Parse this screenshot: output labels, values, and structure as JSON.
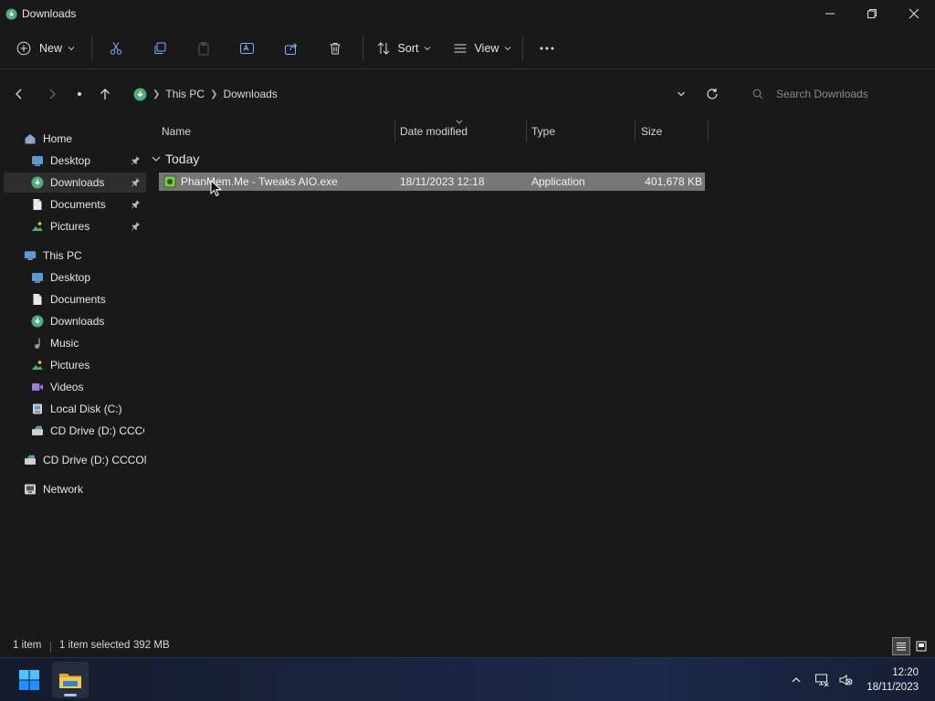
{
  "window": {
    "title": "Downloads"
  },
  "toolbar": {
    "new_label": "New",
    "sort_label": "Sort",
    "view_label": "View"
  },
  "address": {
    "segments": [
      "This PC",
      "Downloads"
    ]
  },
  "search": {
    "placeholder": "Search Downloads"
  },
  "sidebar": {
    "home": "Home",
    "quick_access": [
      {
        "label": "Desktop",
        "icon": "desktop-icon"
      },
      {
        "label": "Downloads",
        "icon": "download-icon"
      },
      {
        "label": "Documents",
        "icon": "document-icon"
      },
      {
        "label": "Pictures",
        "icon": "pictures-icon"
      }
    ],
    "this_pc": "This PC",
    "this_pc_items": [
      {
        "label": "Desktop",
        "icon": "desktop-icon"
      },
      {
        "label": "Documents",
        "icon": "document-icon"
      },
      {
        "label": "Downloads",
        "icon": "download-icon"
      },
      {
        "label": "Music",
        "icon": "music-icon"
      },
      {
        "label": "Pictures",
        "icon": "pictures-icon"
      },
      {
        "label": "Videos",
        "icon": "videos-icon"
      },
      {
        "label": "Local Disk (C:)",
        "icon": "drive-icon"
      },
      {
        "label": "CD Drive (D:) CCCOi",
        "icon": "cd-drive-icon"
      }
    ],
    "cd_drive": "CD Drive (D:) CCCOM",
    "network": "Network"
  },
  "columns": {
    "name": "Name",
    "date": "Date modified",
    "type": "Type",
    "size": "Size"
  },
  "group": {
    "label": "Today"
  },
  "files": [
    {
      "name": "PhanMem.Me - Tweaks AIO.exe",
      "date": "18/11/2023 12:18",
      "type": "Application",
      "size": "401,678 KB"
    }
  ],
  "status": {
    "count": "1 item",
    "selected": "1 item selected",
    "size": "392 MB"
  },
  "clock": {
    "time": "12:20",
    "date": "18/11/2023"
  },
  "colors": {
    "accent": "#0078d4",
    "selection": "#777777",
    "background": "#191919"
  }
}
